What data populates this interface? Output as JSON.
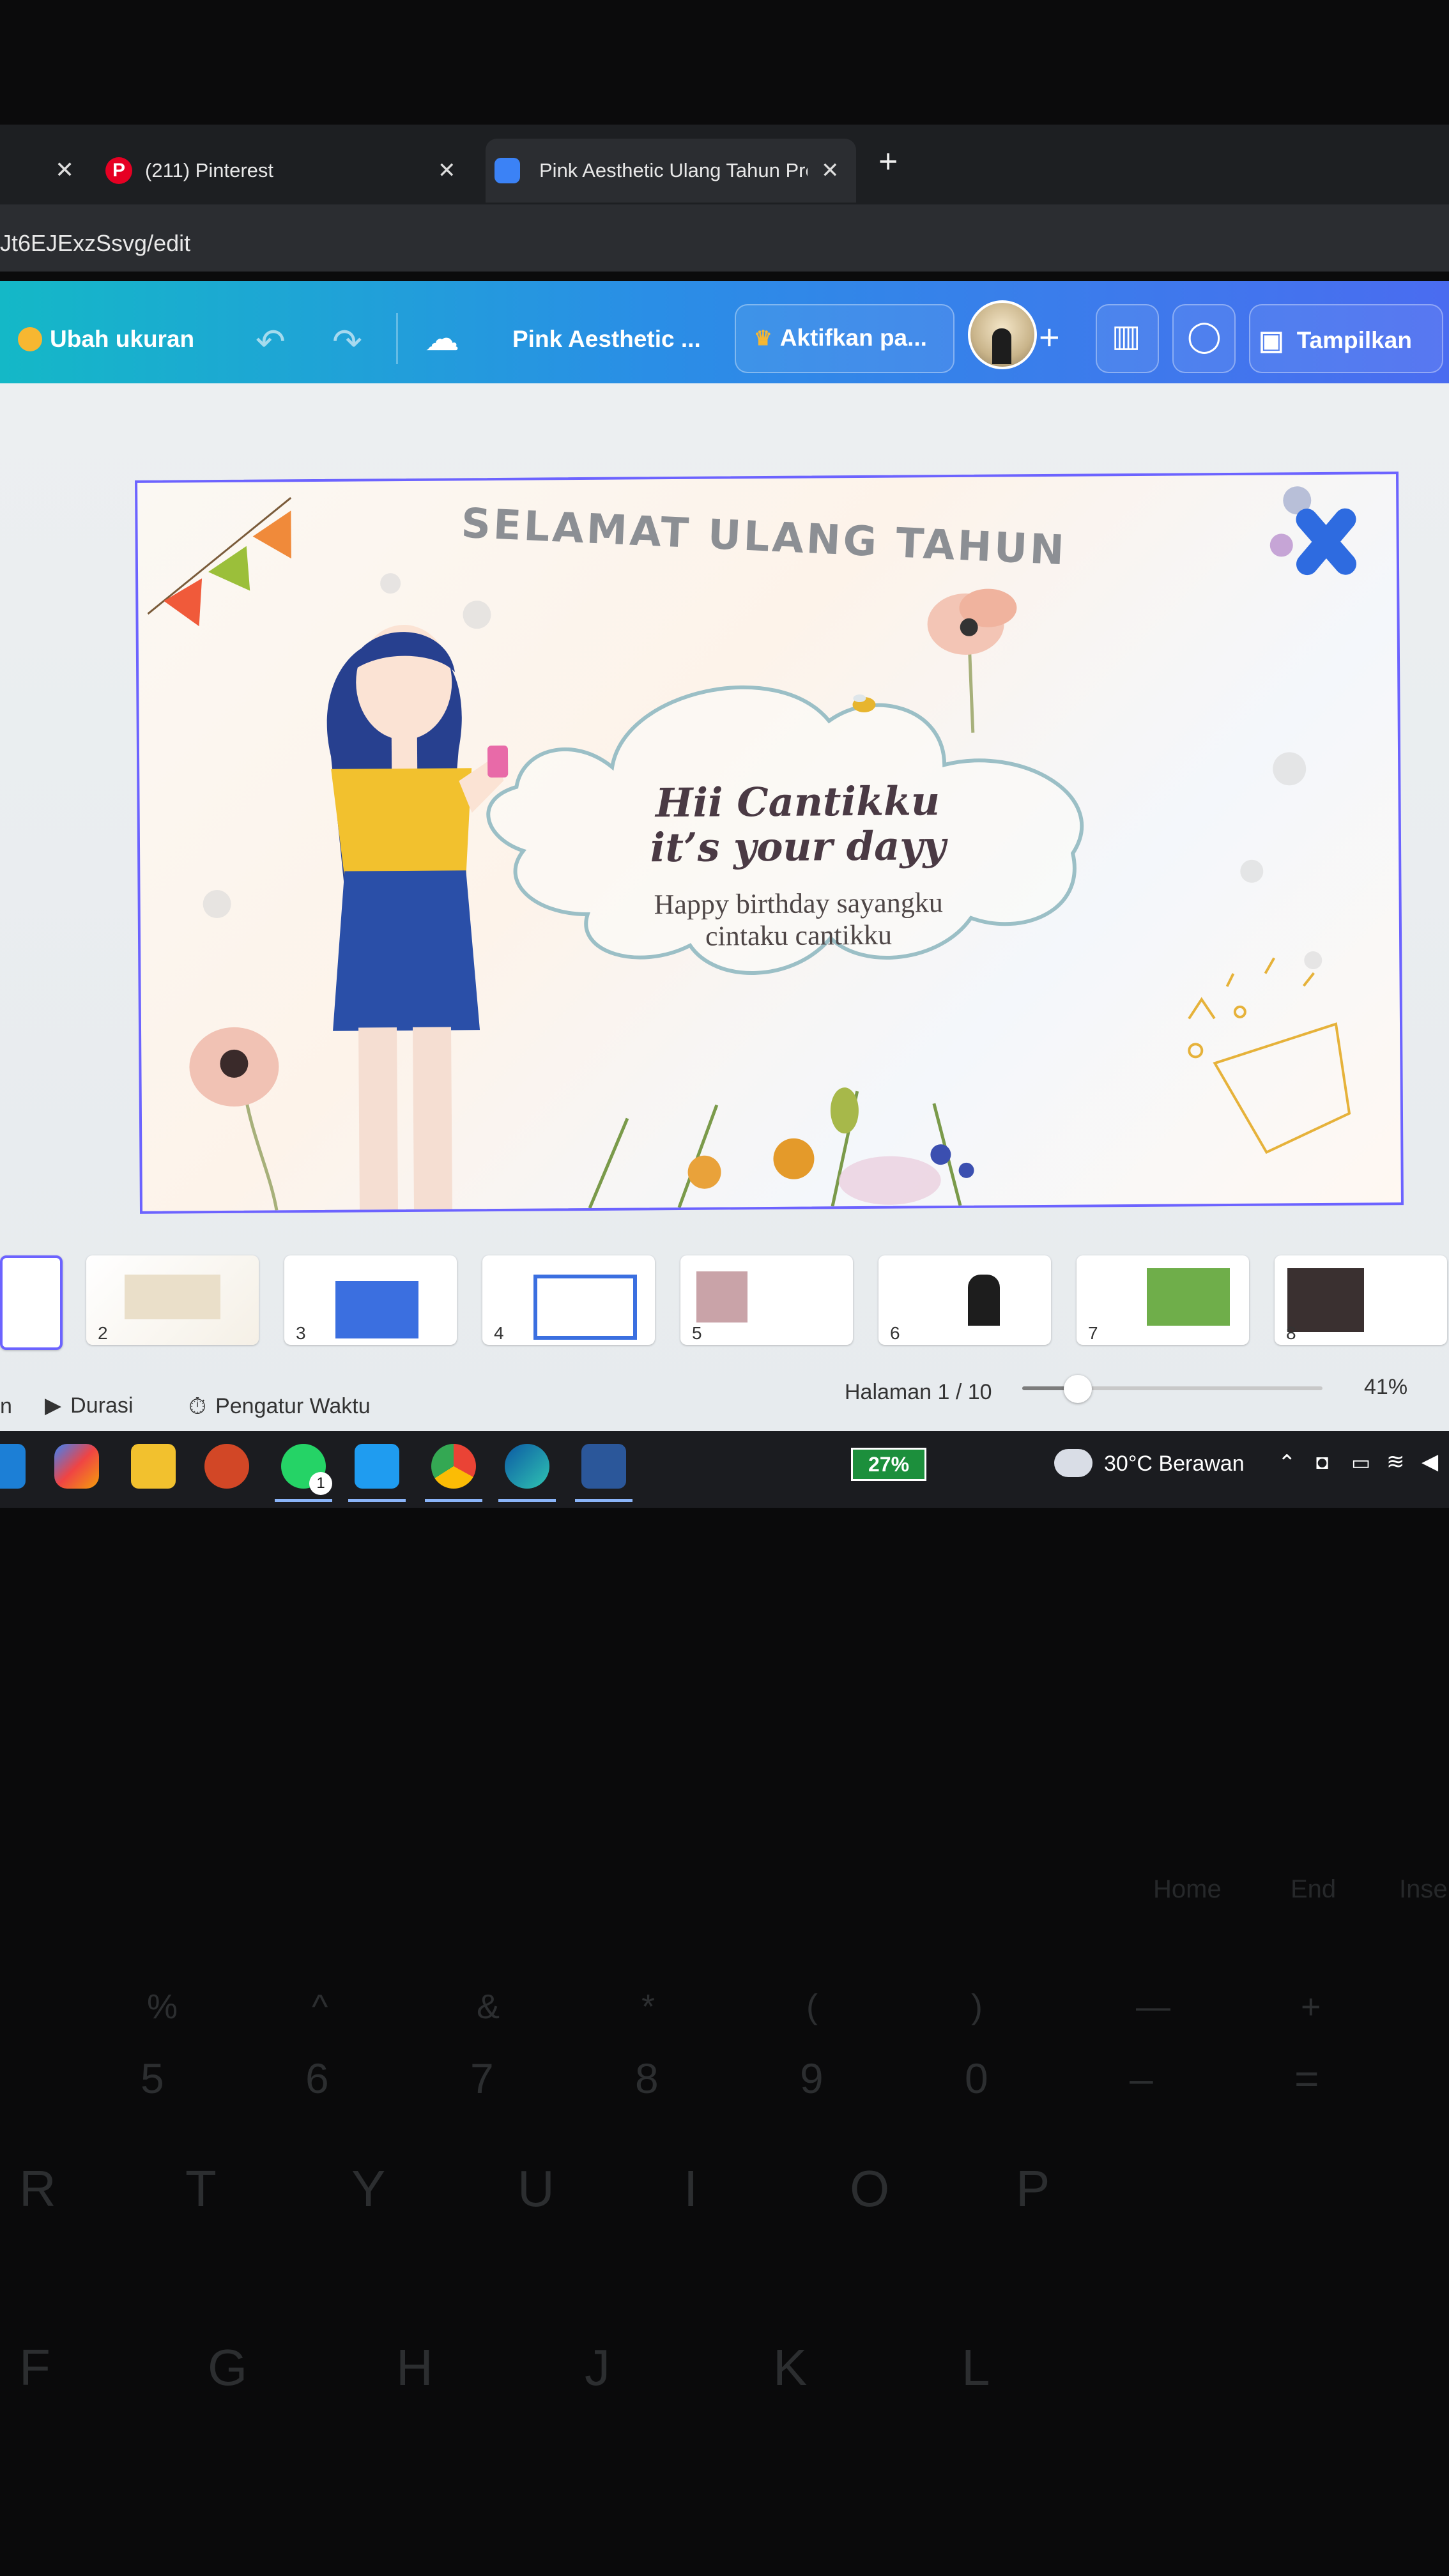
{
  "browser": {
    "tabs": [
      {
        "title": "(211) Pinterest",
        "active": false
      },
      {
        "title": "Pink Aesthetic Ulang Tahun Pre",
        "active": true
      }
    ],
    "url_fragment": "Jt6EJExzSsvg/edit"
  },
  "toolbar": {
    "resize_label": "Ubah ukuran",
    "doc_title": "Pink Aesthetic ...",
    "activate_label": "Aktifkan pa...",
    "present_label": "Tampilkan",
    "add_symbol": "+"
  },
  "slide": {
    "heading": "SELAMAT ULANG TAHUN",
    "line1": "Hii Cantikku",
    "line2": "it’s your dayy",
    "line3": "Happy birthday sayangku",
    "line4": "cintaku cantikku",
    "accent_colors": {
      "cloud": "#9bbfc6",
      "heading": "#8c8f94",
      "shirt": "#f2c12e",
      "skirt": "#2a4fa8",
      "hair": "#27408f"
    }
  },
  "thumbnails": [
    "2",
    "3",
    "4",
    "5",
    "6",
    "7",
    "8"
  ],
  "status": {
    "left_fragment": "n",
    "duration": "Durasi",
    "timer": "Pengatur Waktu",
    "page": "Halaman 1 / 10",
    "zoom": "41%",
    "zoom_level_fraction": 0.41
  },
  "taskbar": {
    "battery": "27%",
    "weather": "30°C Berawan",
    "whatsapp_badge": "1"
  },
  "keyboard": {
    "fn_row": [
      "Home",
      "End",
      "Inse"
    ],
    "num_row": [
      {
        "top": "%",
        "bottom": "5"
      },
      {
        "top": "^",
        "bottom": "6"
      },
      {
        "top": "&",
        "bottom": "7"
      },
      {
        "top": "*",
        "bottom": "8"
      },
      {
        "top": "(",
        "bottom": "9"
      },
      {
        "top": ")",
        "bottom": "0"
      },
      {
        "top": "—",
        "bottom": "–"
      },
      {
        "top": "+",
        "bottom": "="
      }
    ],
    "letter_row1": [
      "R",
      "T",
      "Y",
      "U",
      "I",
      "O",
      "P"
    ],
    "letter_row2": [
      "F",
      "G",
      "H",
      "J",
      "K",
      "L"
    ]
  }
}
